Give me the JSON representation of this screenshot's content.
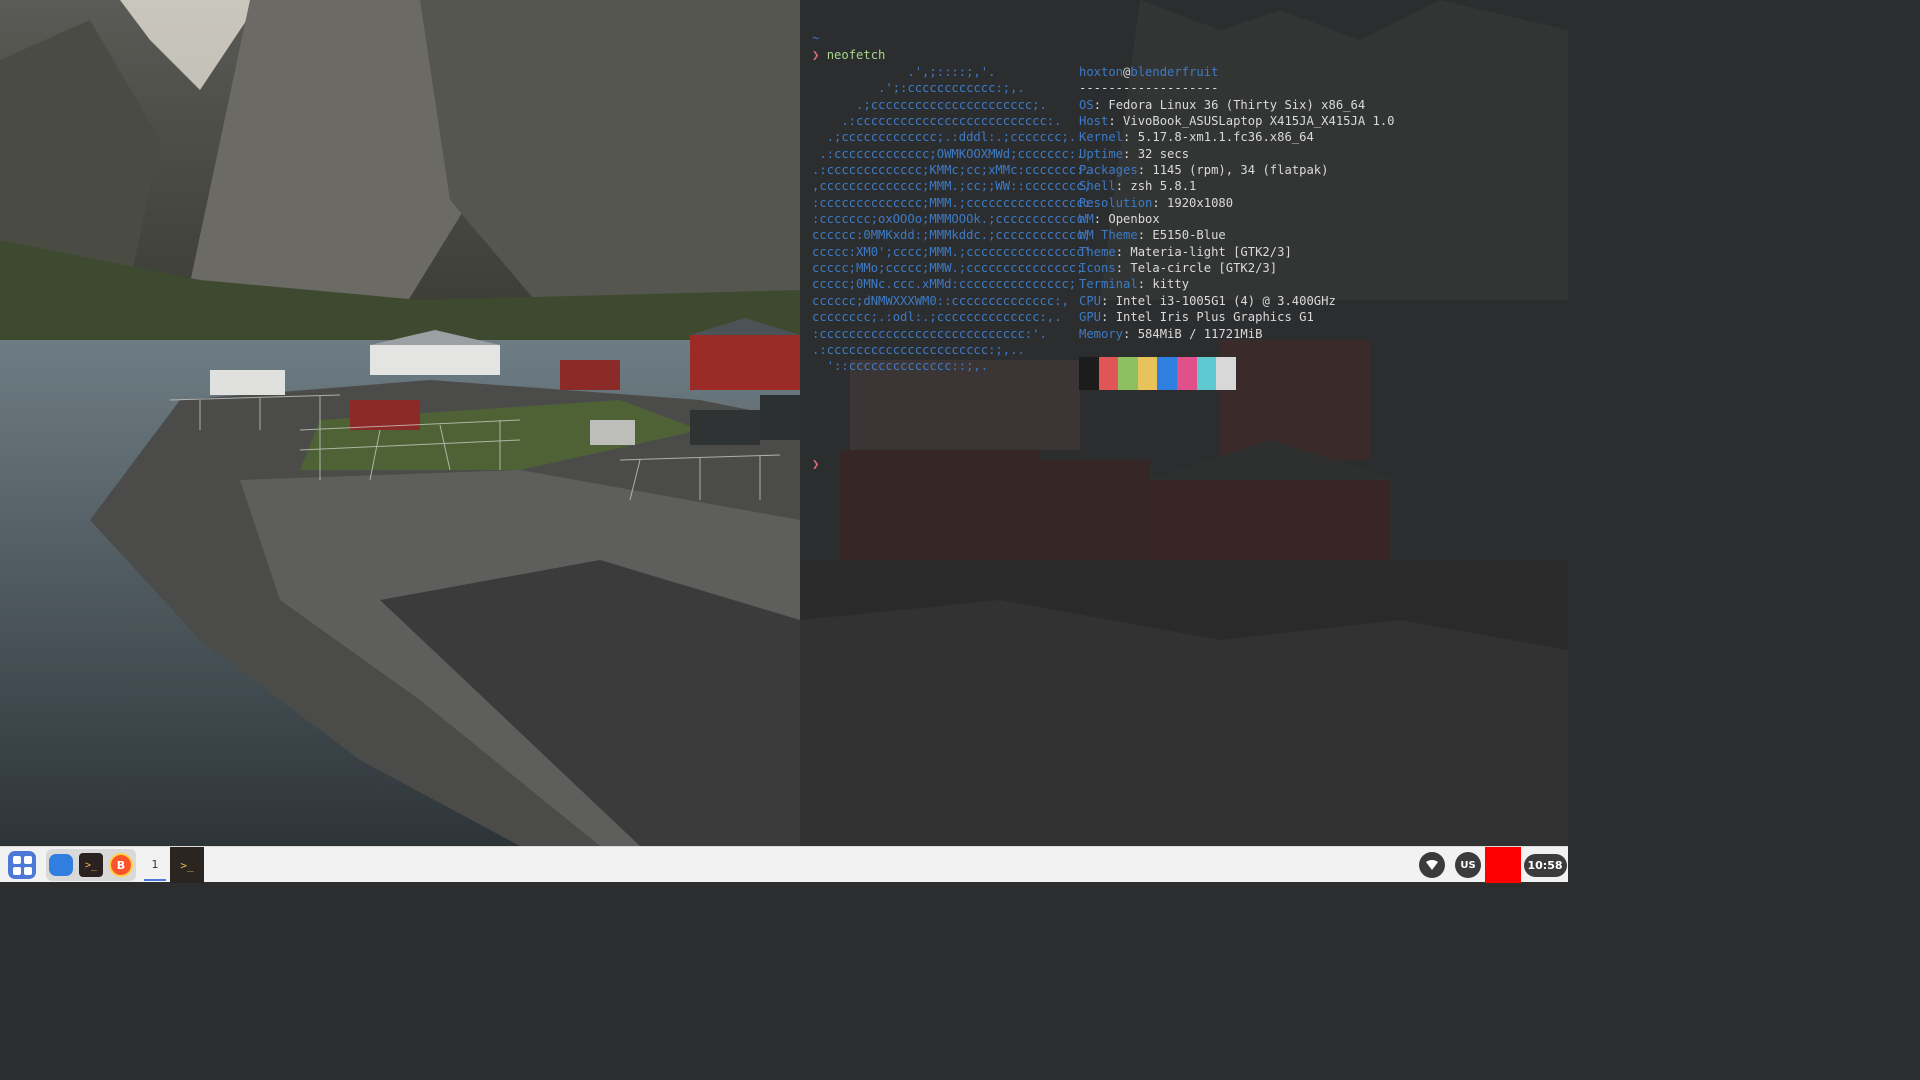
{
  "terminal": {
    "top_marker": "~",
    "prompt_symbol": "❯",
    "command": "neofetch",
    "ascii_art": [
      "             .',;::::;,'.",
      "         .';:cccccccccccc:;,.",
      "      .;cccccccccccccccccccccc;.",
      "    .:cccccccccccccccccccccccccc:.",
      "  .;ccccccccccccc;.:dddl:.;ccccccc;.",
      " .:ccccccccccccc;OWMKOOXMWd;ccccccc:.",
      ".:ccccccccccccc;KMMc;cc;xMMc:ccccccc:.",
      ",cccccccccccccc;MMM.;cc;;WW::cccccccc,",
      ":cccccccccccccc;MMM.;cccccccccccccccc:",
      ":ccccccc;oxOOOo;MMMOOOk.;cccccccccccc:",
      "cccccc:0MMKxdd:;MMMkddc.;cccccccccccc;",
      "ccccc:XM0';cccc;MMM.;cccccccccccccccc'",
      "ccccc;MMo;ccccc;MMW.;ccccccccccccccc;",
      "ccccc;0MNc.ccc.xMMd:ccccccccccccccc;",
      "cccccc;dNMWXXXWM0::cccccccccccccc:,",
      "cccccccc;.:odl:.;cccccccccccccc:,.",
      ":cccccccccccccccccccccccccccc:'.",
      ".:cccccccccccccccccccccc:;,..",
      "  '::cccccccccccccc::;,."
    ],
    "user": "hoxton",
    "at": "@",
    "host": "blenderfruit",
    "separator": "-------------------",
    "info": [
      {
        "key": "OS",
        "value": ": Fedora Linux 36 (Thirty Six) x86_64"
      },
      {
        "key": "Host",
        "value": ": VivoBook_ASUSLaptop X415JA_X415JA 1.0"
      },
      {
        "key": "Kernel",
        "value": ": 5.17.8-xm1.1.fc36.x86_64"
      },
      {
        "key": "Uptime",
        "value": ": 32 secs"
      },
      {
        "key": "Packages",
        "value": ": 1145 (rpm), 34 (flatpak)"
      },
      {
        "key": "Shell",
        "value": ": zsh 5.8.1"
      },
      {
        "key": "Resolution",
        "value": ": 1920x1080"
      },
      {
        "key": "WM",
        "value": ": Openbox"
      },
      {
        "key": "WM Theme",
        "value": ": E5150-Blue"
      },
      {
        "key": "Theme",
        "value": ": Materia-light [GTK2/3]"
      },
      {
        "key": "Icons",
        "value": ": Tela-circle [GTK2/3]"
      },
      {
        "key": "Terminal",
        "value": ": kitty"
      },
      {
        "key": "CPU",
        "value": ": Intel i3-1005G1 (4) @ 3.400GHz"
      },
      {
        "key": "GPU",
        "value": ": Intel Iris Plus Graphics G1"
      },
      {
        "key": "Memory",
        "value": ": 584MiB / 11721MiB"
      }
    ],
    "palette": [
      "#1c1c1c",
      "#e05555",
      "#8dc060",
      "#e8c25a",
      "#2f7fe0",
      "#e0508a",
      "#5fc8d0",
      "#d8d8d8"
    ],
    "colors": {
      "accent": "#3d7bc6",
      "prompt": "#e06c75",
      "command": "#a7d58a"
    }
  },
  "taskbar": {
    "launcher_icon": "app-grid-icon",
    "apps": [
      {
        "name": "files-icon"
      },
      {
        "name": "terminal-app-icon"
      },
      {
        "name": "brave-browser-icon",
        "glyph": "B"
      }
    ],
    "workspace": "1",
    "task_glyph": ">_",
    "keyboard_layout": "US",
    "clock": "10:58",
    "tray_color": "#ff0000"
  }
}
